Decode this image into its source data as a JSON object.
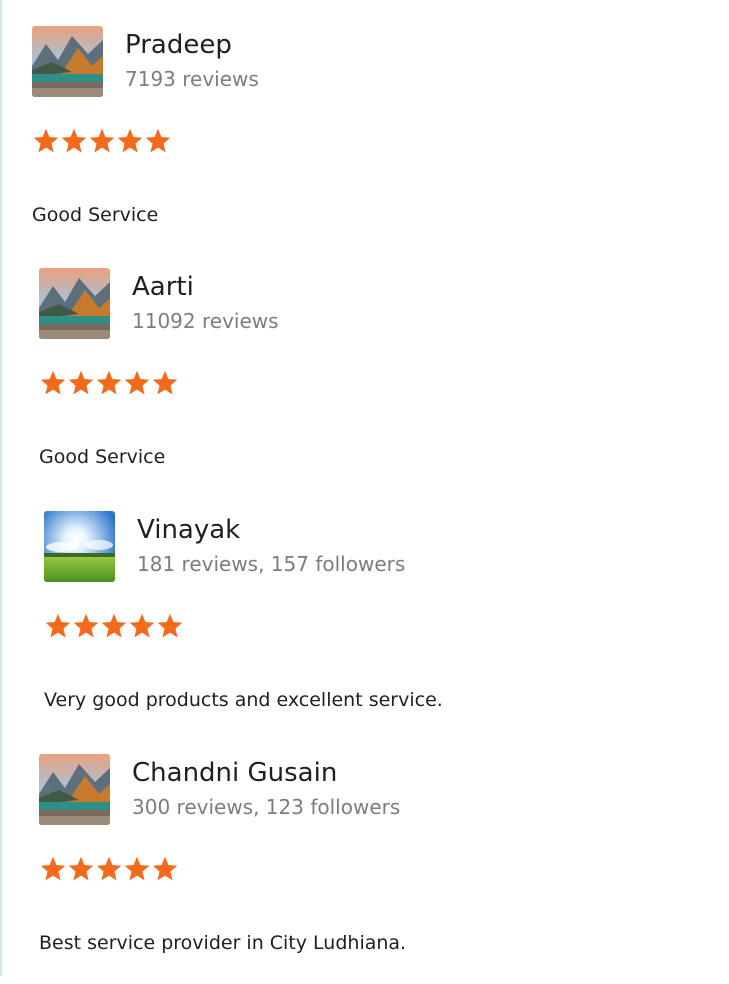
{
  "reviews": [
    {
      "name": "Pradeep",
      "meta": "7193 reviews",
      "rating": 5,
      "comment": "Good Service",
      "avatar_icon": "mountain-lake-photo"
    },
    {
      "name": "Aarti",
      "meta": "11092 reviews",
      "rating": 5,
      "comment": "Good Service",
      "avatar_icon": "mountain-lake-photo"
    },
    {
      "name": "Vinayak",
      "meta": "181 reviews, 157 followers",
      "rating": 5,
      "comment": "Very good products and excellent service.",
      "avatar_icon": "sunny-meadow-photo"
    },
    {
      "name": "Chandni Gusain",
      "meta": "300 reviews, 123 followers",
      "rating": 5,
      "comment": "Best service provider in City Ludhiana.",
      "avatar_icon": "mountain-lake-photo"
    }
  ],
  "colors": {
    "star": "#f26a1b",
    "name": "#1f1f1f",
    "meta": "#7d7d7d"
  }
}
